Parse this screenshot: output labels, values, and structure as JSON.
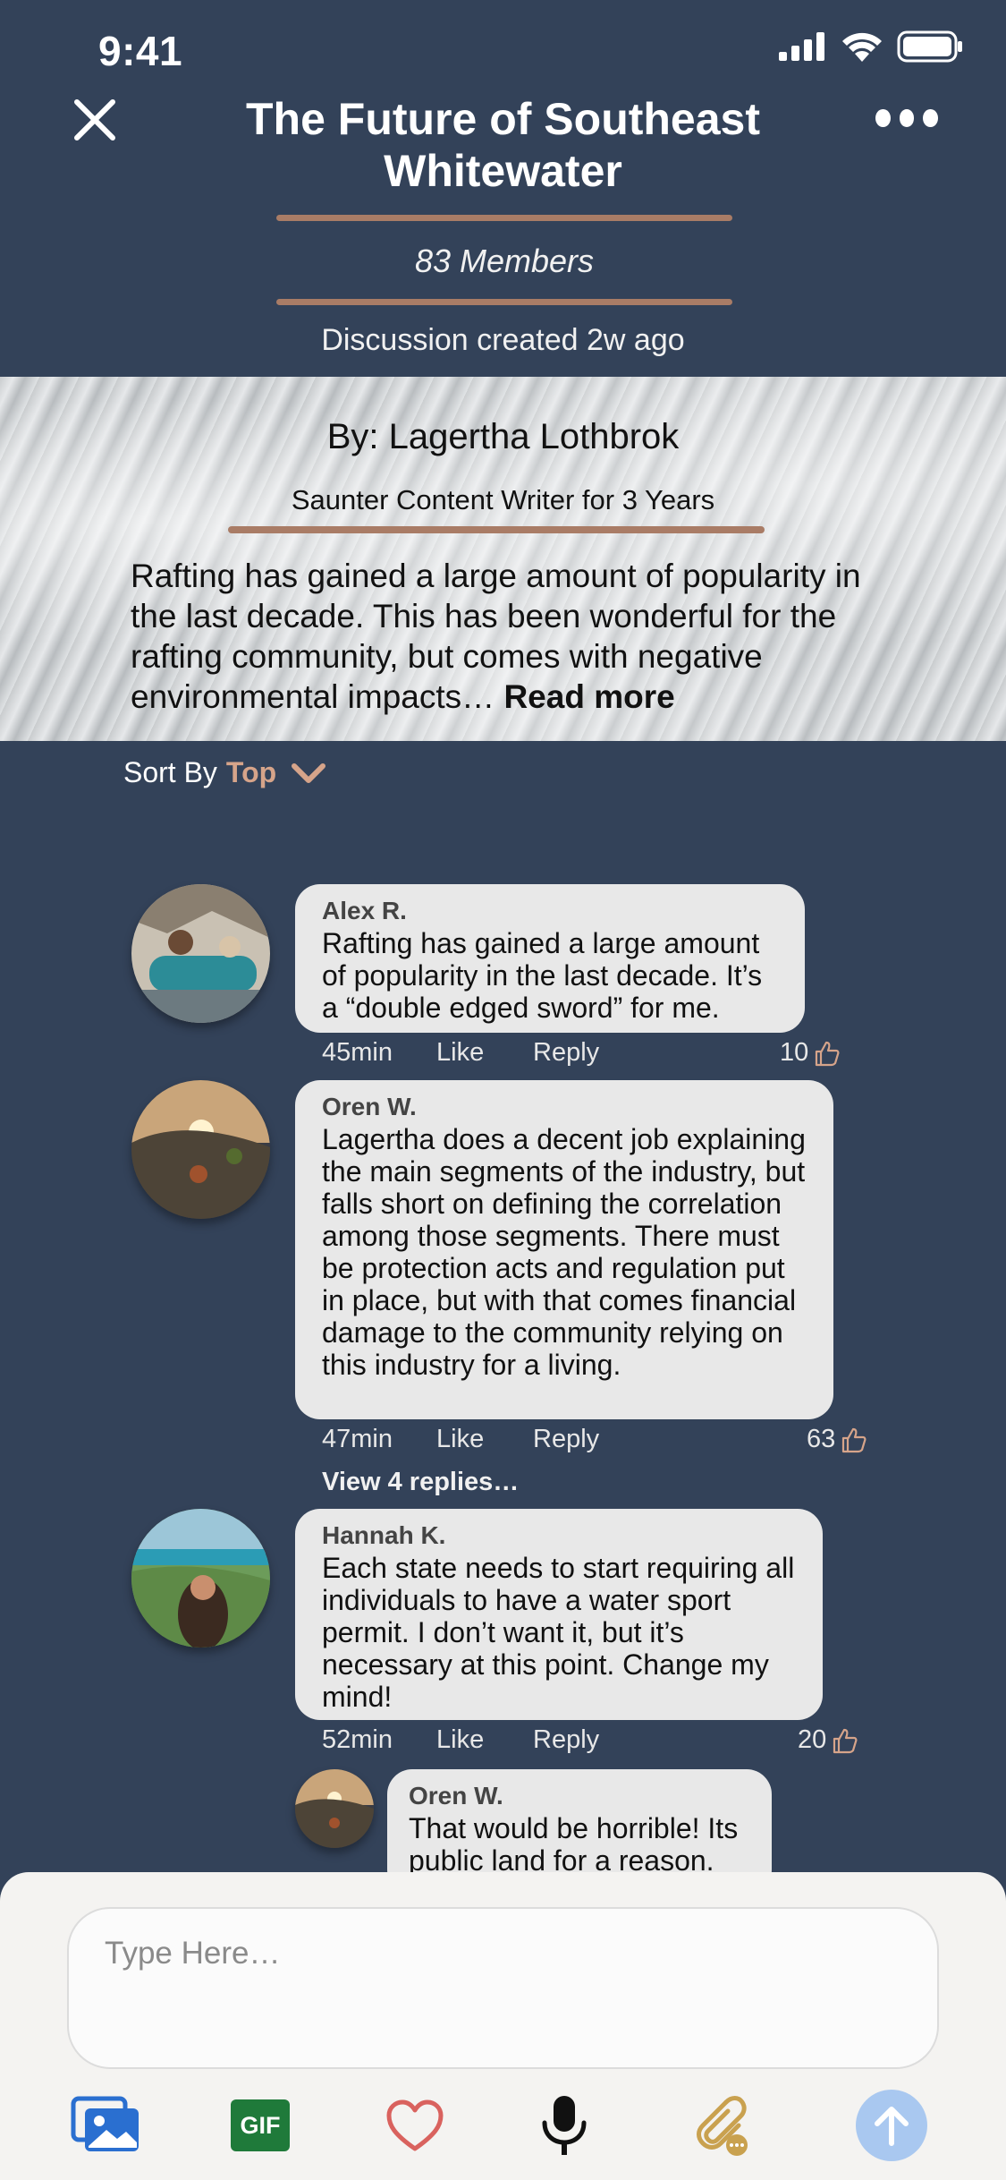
{
  "status_bar": {
    "time": "9:41"
  },
  "header": {
    "title": "The Future of Southeast Whitewater",
    "members": "83 Members",
    "created": "Discussion created 2w ago"
  },
  "post": {
    "author": "By: Lagertha Lothbrok",
    "author_subtitle": "Saunter Content Writer for 3 Years",
    "excerpt": "Rafting has gained a large amount of popularity in the last decade. This has been wonderful for the rafting community, but comes with negative environmental impacts… ",
    "read_more": "Read more"
  },
  "sort": {
    "label": "Sort By",
    "value": "Top"
  },
  "comments": [
    {
      "name": "Alex R.",
      "text": "Rafting has gained a large amount of popularity in the last decade. It’s a “double edged sword” for me.",
      "time": "45min",
      "like": "Like",
      "reply": "Reply",
      "likes": "10"
    },
    {
      "name": "Oren W.",
      "text": "Lagertha does a decent job explaining the main segments of the industry, but falls short on defining the correlation among those segments. There must be protection acts and regulation put in place, but with that comes financial damage to the community relying on this industry for a living.",
      "time": "47min",
      "like": "Like",
      "reply": "Reply",
      "likes": "63",
      "view_replies": "View 4 replies…"
    },
    {
      "name": "Hannah K.",
      "text": "Each state needs to start requiring all individuals to have a water sport permit. I don’t want it, but it’s necessary at this point. Change my mind!",
      "time": "52min",
      "like": "Like",
      "reply": "Reply",
      "likes": "20"
    }
  ],
  "reply": {
    "name": "Oren W.",
    "text": "That would be horrible! Its public land for a reason."
  },
  "composer": {
    "placeholder": "Type Here…",
    "gif_label": "GIF"
  },
  "colors": {
    "background": "#334259",
    "accent_rule": "#a97c66",
    "sort_value": "#d6a48a",
    "bubble": "#e8e8e8",
    "send_button": "#a9c8f0"
  },
  "icons": [
    "close-icon",
    "more-icon",
    "chevron-down-icon",
    "thumbs-up-icon",
    "photo-gallery-icon",
    "gif-icon",
    "heart-icon",
    "microphone-icon",
    "attachment-icon",
    "send-arrow-icon"
  ]
}
